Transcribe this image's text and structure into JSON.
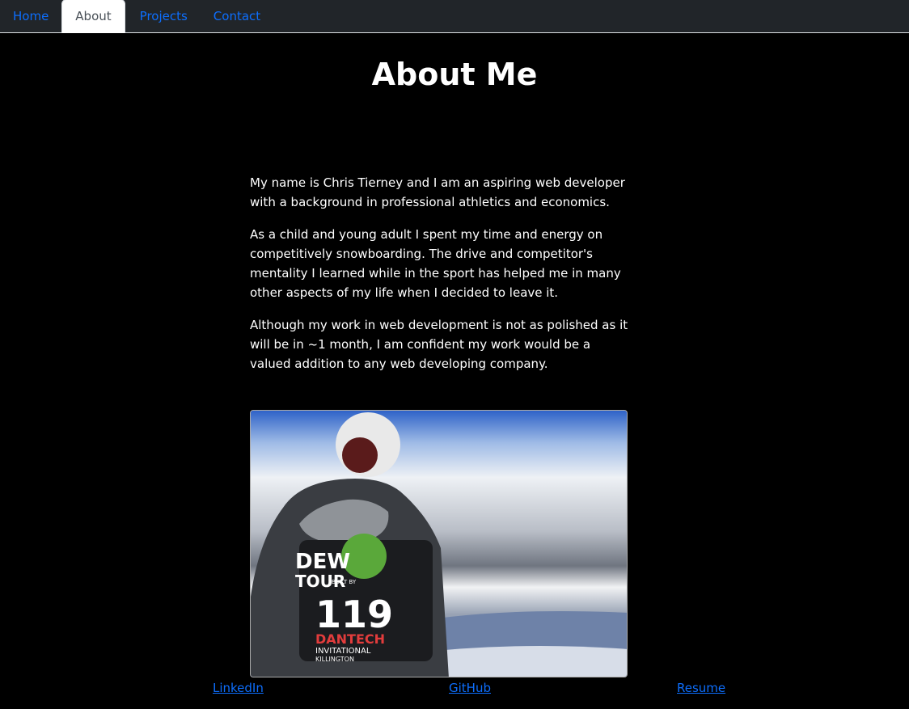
{
  "nav": {
    "tabs": [
      {
        "label": "Home",
        "active": false
      },
      {
        "label": "About",
        "active": true
      },
      {
        "label": "Projects",
        "active": false
      },
      {
        "label": "Contact",
        "active": false
      }
    ]
  },
  "page": {
    "title": "About Me",
    "paragraphs": [
      "My name is Chris Tierney and I am an aspiring web developer with a background in professional athletics and economics.",
      "As a child and young adult I spent my time and energy on competitively snowboarding. The drive and competitor's mentality I learned while in the sport has helped me in many other aspects of my life when I decided to leave it.",
      "Although my work in web development is not as polished as it will be in ~1 month, I am confident my work would be a valued addition to any web developing company."
    ],
    "photo": {
      "bib_texts": [
        "DEW",
        "TOUR",
        "BUILT BY",
        "119",
        "DANTECH",
        "INVITATIONAL",
        "KILLINGTON"
      ]
    }
  },
  "footer": {
    "links": [
      {
        "label": "LinkedIn"
      },
      {
        "label": "GitHub"
      },
      {
        "label": "Resume"
      }
    ]
  },
  "colors": {
    "link": "#0d6efd",
    "navbar_bg": "#212529",
    "page_bg": "#000000",
    "text": "#ffffff"
  }
}
